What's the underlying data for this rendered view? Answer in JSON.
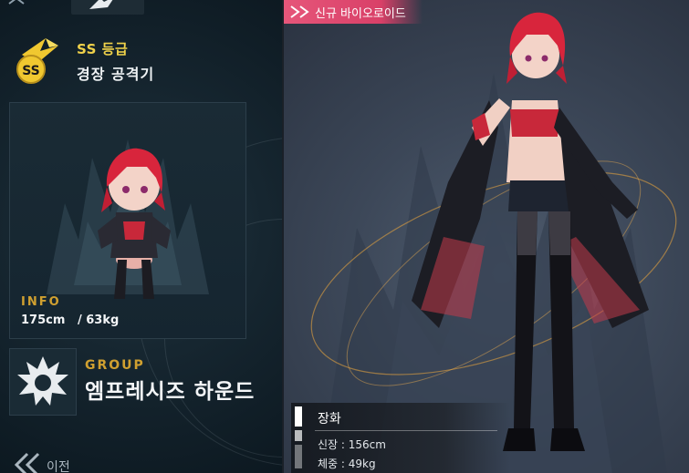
{
  "left_panel": {
    "grade": {
      "emblem_letters": "SS",
      "label": "SS 등급"
    },
    "role": "경장 공격기",
    "info": {
      "label": "INFO",
      "height": "175cm",
      "weight": "/ 63kg"
    },
    "group": {
      "label": "GROUP",
      "name": "엠프레시즈 하운드"
    },
    "nav": {
      "prev_label": "이전"
    }
  },
  "right_panel": {
    "badge_label": "신규 바이오로이드",
    "character": {
      "name": "장화",
      "height_line": "신장 : 156cm",
      "weight_line": "체중 : 49kg"
    }
  },
  "colors": {
    "accent_gold": "#d0a030",
    "grade_yellow": "#f0d24a",
    "badge_pink": "#e6567a",
    "panel_dark": "#0d1a24"
  }
}
